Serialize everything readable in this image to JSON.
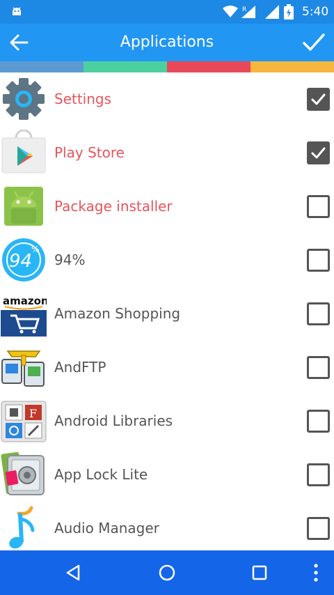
{
  "status_bar": {
    "time": "5:40",
    "signal_badge": "R",
    "icons": [
      "android-debug-icon",
      "wifi-icon",
      "signal-icon",
      "battery-icon"
    ]
  },
  "toolbar": {
    "title": "Applications",
    "back_icon": "arrow-left-icon",
    "confirm_icon": "checkmark-icon"
  },
  "theme": {
    "toolbar": "#2196f3",
    "status_bar": "#1e88e5",
    "nav_bar": "#1565e8"
  },
  "color_strip": [
    "#5c9bd1",
    "#4dd0a0",
    "#e8485a",
    "#f7b73f"
  ],
  "apps": [
    {
      "label": "Settings",
      "checked": true,
      "highlight": true,
      "icon": "settings-gear-icon"
    },
    {
      "label": "Play Store",
      "checked": true,
      "highlight": true,
      "icon": "play-store-icon"
    },
    {
      "label": "Package installer",
      "checked": false,
      "highlight": true,
      "icon": "android-robot-icon"
    },
    {
      "label": "94%",
      "checked": false,
      "highlight": false,
      "icon": "94-percent-icon"
    },
    {
      "label": "Amazon Shopping",
      "checked": false,
      "highlight": false,
      "icon": "amazon-cart-icon"
    },
    {
      "label": "AndFTP",
      "checked": false,
      "highlight": false,
      "icon": "andftp-icon"
    },
    {
      "label": "Android Libraries",
      "checked": false,
      "highlight": false,
      "icon": "android-libraries-icon"
    },
    {
      "label": "App Lock Lite",
      "checked": false,
      "highlight": false,
      "icon": "safe-lock-icon"
    },
    {
      "label": "Audio Manager",
      "checked": false,
      "highlight": false,
      "icon": "music-note-icon"
    }
  ],
  "icon_text": {
    "ninety_four": "94",
    "amazon": "amazon"
  },
  "nav_bar": {
    "buttons": [
      "back-triangle-icon",
      "home-circle-icon",
      "recents-square-icon",
      "overflow-menu-icon"
    ]
  }
}
